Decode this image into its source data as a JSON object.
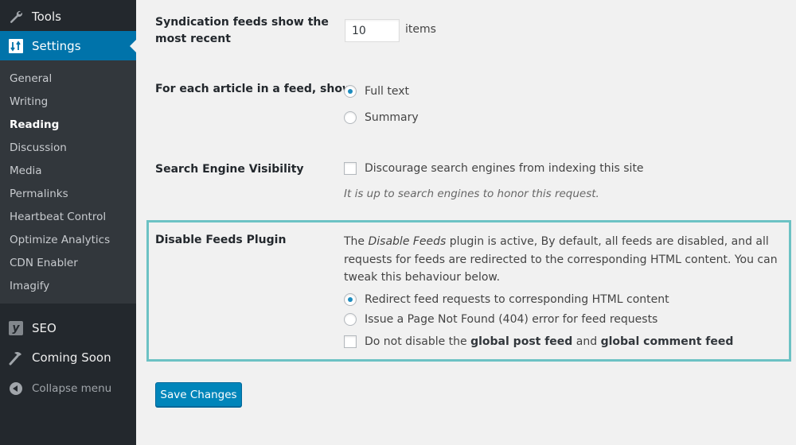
{
  "sidebar": {
    "tools_label": "Tools",
    "settings_label": "Settings",
    "submenu": [
      {
        "label": "General",
        "current": false
      },
      {
        "label": "Writing",
        "current": false
      },
      {
        "label": "Reading",
        "current": true
      },
      {
        "label": "Discussion",
        "current": false
      },
      {
        "label": "Media",
        "current": false
      },
      {
        "label": "Permalinks",
        "current": false
      },
      {
        "label": "Heartbeat Control",
        "current": false
      },
      {
        "label": "Optimize Analytics",
        "current": false
      },
      {
        "label": "CDN Enabler",
        "current": false
      },
      {
        "label": "Imagify",
        "current": false
      }
    ],
    "seo_label": "SEO",
    "seo_badge": "y",
    "coming_soon_label": "Coming Soon",
    "collapse_label": "Collapse menu"
  },
  "settings": {
    "syndication": {
      "label_line1": "Syndication feeds show the",
      "label_line2": "most recent",
      "value": "10",
      "unit": "items"
    },
    "article_feed": {
      "label": "For each article in a feed, show",
      "options": [
        {
          "label": "Full text",
          "checked": true
        },
        {
          "label": "Summary",
          "checked": false
        }
      ]
    },
    "search_visibility": {
      "label": "Search Engine Visibility",
      "checkbox_label": "Discourage search engines from indexing this site",
      "checked": false,
      "description": "It is up to search engines to honor this request."
    },
    "disable_feeds": {
      "label": "Disable Feeds Plugin",
      "desc_prefix": "The ",
      "desc_plugin_name": "Disable Feeds",
      "desc_rest": " plugin is active, By default, all feeds are disabled, and all requests for feeds are redirected to the corresponding HTML content. You can tweak this behaviour below.",
      "options": [
        {
          "label": "Redirect feed requests to corresponding HTML content",
          "checked": true
        },
        {
          "label": "Issue a Page Not Found (404) error for feed requests",
          "checked": false
        }
      ],
      "checkbox": {
        "text_1": "Do not disable the ",
        "bold_1": "global post feed",
        "text_2": " and ",
        "bold_2": "global comment feed",
        "checked": false
      },
      "highlight_color": "#6cc2c4"
    }
  },
  "save_button_label": "Save Changes",
  "colors": {
    "accent": "#0073aa",
    "button": "#0085ba",
    "sidebar_bg": "#23282d",
    "submenu_bg": "#32373c"
  }
}
